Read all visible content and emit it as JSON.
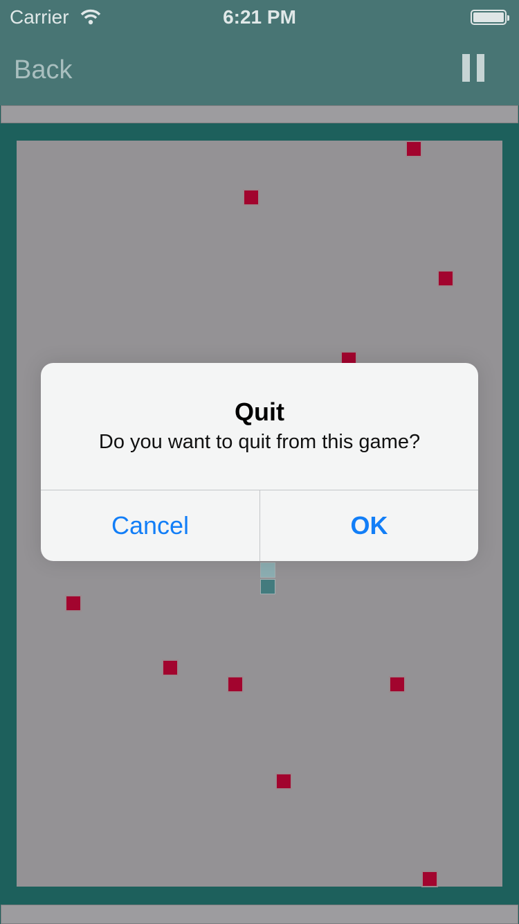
{
  "status_bar": {
    "carrier": "Carrier",
    "time": "6:21 PM",
    "wifi_icon": "wifi-icon",
    "battery_icon": "battery-icon"
  },
  "nav": {
    "back_label": "Back",
    "pause_icon": "pause-icon"
  },
  "colors": {
    "accent": "#487574",
    "board_border": "#1d605c",
    "field": "#949295",
    "obstacle": "#a2042e",
    "snake_head": "#8caeb2",
    "snake_body": "#437b7e",
    "alert_button": "#127ef7"
  },
  "alert": {
    "title": "Quit",
    "message": "Do you want to quit from this game?",
    "cancel_label": "Cancel",
    "ok_label": "OK"
  }
}
